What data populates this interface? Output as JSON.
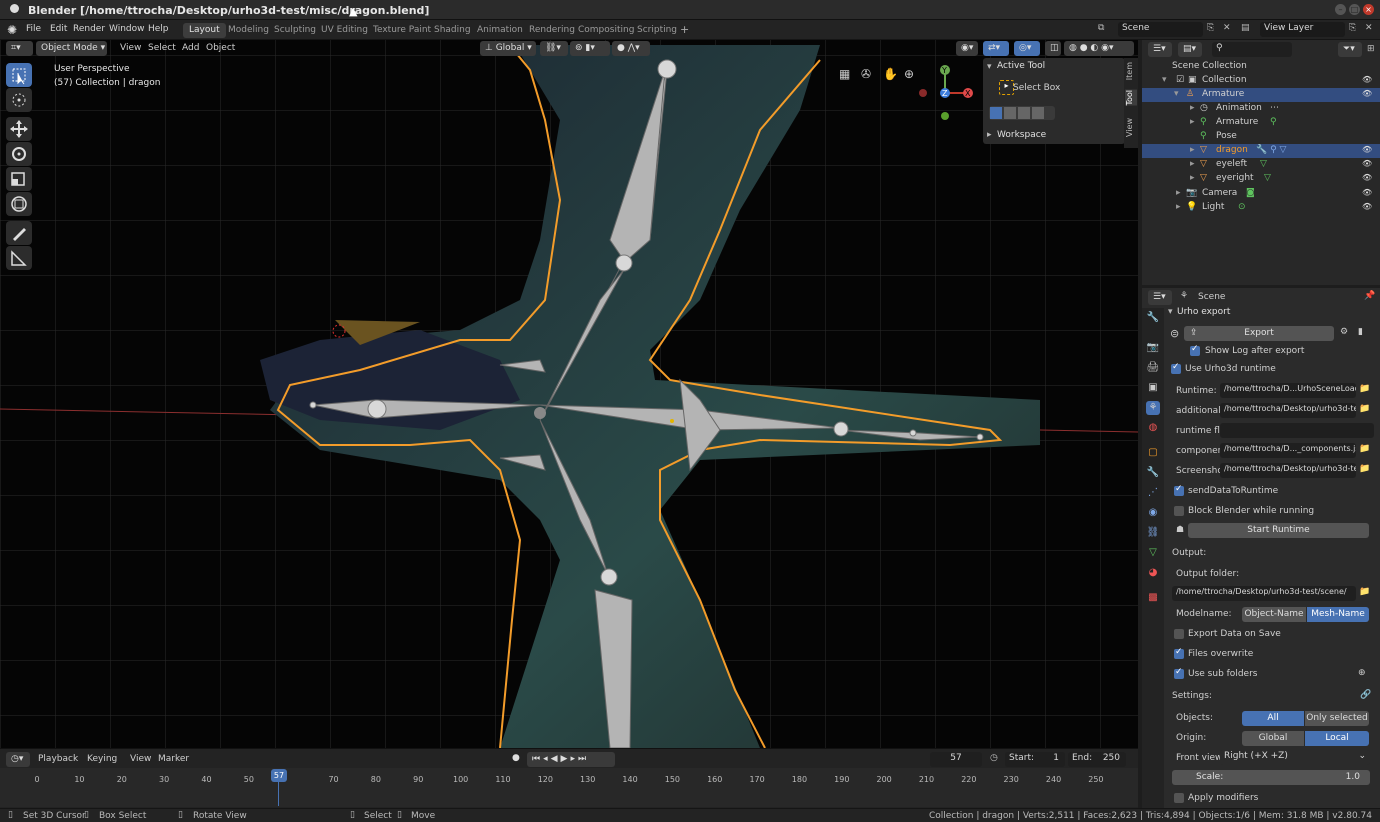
{
  "window": {
    "title": "Blender [/home/ttrocha/Desktop/urho3d-test/misc/dragon.blend]"
  },
  "menu": [
    "File",
    "Edit",
    "Render",
    "Window",
    "Help"
  ],
  "workspaces": [
    "Layout",
    "Modeling",
    "Sculpting",
    "UV Editing",
    "Texture Paint",
    "Shading",
    "Animation",
    "Rendering",
    "Compositing",
    "Scripting"
  ],
  "scene": {
    "name": "Scene",
    "view_layer": "View Layer"
  },
  "viewport": {
    "mode": "Object Mode",
    "menus": [
      "View",
      "Select",
      "Add",
      "Object"
    ],
    "orientation": "Global",
    "overlay_title": "User Perspective",
    "overlay_sub": "(57) Collection | dragon",
    "gizmo": {
      "x": "X",
      "y": "Y",
      "z": "Z"
    }
  },
  "npanel": {
    "active_tool_header": "Active Tool",
    "tool_name": "Select Box",
    "workspace_header": "Workspace",
    "tabs": [
      "Item",
      "Tool",
      "View"
    ]
  },
  "outliner": {
    "root": "Scene Collection",
    "rows": [
      {
        "label": "Collection"
      },
      {
        "label": "Armature"
      },
      {
        "label": "Animation"
      },
      {
        "label": "Armature"
      },
      {
        "label": "Pose"
      },
      {
        "label": "dragon"
      },
      {
        "label": "eyeleft"
      },
      {
        "label": "eyeright"
      },
      {
        "label": "Camera"
      },
      {
        "label": "Light"
      }
    ]
  },
  "properties": {
    "context": "Scene",
    "panel": "Urho export",
    "export_btn": "Export",
    "show_log": "Show Log after export",
    "use_runtime": "Use Urho3d runtime",
    "fields": [
      {
        "label": "Runtime:",
        "value": "/home/ttrocha/D...UrhoSceneLoader"
      },
      {
        "label": "additional ...",
        "value": "/home/ttrocha/Desktop/urho3d-tes..."
      },
      {
        "label": "runtime fl...",
        "value": ""
      },
      {
        "label": "componen...",
        "value": "/home/ttrocha/D..._components.json"
      },
      {
        "label": "Screensho...",
        "value": "/home/ttrocha/Desktop/urho3d-tes..."
      }
    ],
    "send_data": "sendDataToRuntime",
    "block_blender": "Block Blender while running",
    "start_runtime": "Start Runtime",
    "output_label": "Output:",
    "output_folder_label": "Output folder:",
    "output_folder": "/home/ttrocha/Desktop/urho3d-test/scene/",
    "modelname_label": "Modelname:",
    "modelname_opts": [
      "Object-Name",
      "Mesh-Name"
    ],
    "export_on_save": "Export Data on Save",
    "files_overwrite": "Files overwrite",
    "use_sub_folders": "Use sub folders",
    "settings_label": "Settings:",
    "objects_label": "Objects:",
    "objects_opts": [
      "All",
      "Only selected"
    ],
    "origin_label": "Origin:",
    "origin_opts": [
      "Global",
      "Local"
    ],
    "front_view_label": "Front view:",
    "front_view": "Right (+X +Z)",
    "scale_label": "Scale:",
    "scale_value": "1.0",
    "apply_modifiers": "Apply modifiers"
  },
  "timeline": {
    "menus": [
      "Playback",
      "Keying",
      "View",
      "Marker"
    ],
    "current_frame": "57",
    "start_label": "Start:",
    "start": "1",
    "end_label": "End:",
    "end": "250",
    "ticks": [
      "0",
      "10",
      "20",
      "30",
      "40",
      "50",
      "57",
      "70",
      "80",
      "90",
      "100",
      "110",
      "120",
      "130",
      "140",
      "150",
      "160",
      "170",
      "180",
      "190",
      "200",
      "210",
      "220",
      "230",
      "240",
      "250"
    ]
  },
  "status": {
    "hints": [
      "Set 3D Cursor",
      "Box Select",
      "Rotate View",
      "Select",
      "Move"
    ],
    "stats": "Collection | dragon | Verts:2,511 | Faces:2,623 | Tris:4,894 | Objects:1/6 | Mem: 31.8 MB | v2.80.74"
  },
  "colors": {
    "accent": "#4772b3",
    "selection": "#334d80",
    "outline": "#f39c2a"
  }
}
